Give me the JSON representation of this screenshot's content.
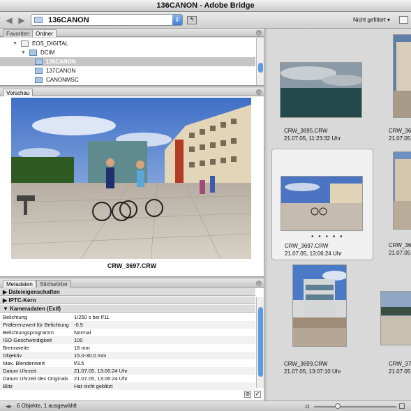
{
  "window": {
    "title": "136CANON - Adobe Bridge"
  },
  "toolbar": {
    "path": "136CANON",
    "filter": "Nicht gefiltert"
  },
  "folder_panel": {
    "tabs": [
      "Favoriten",
      "Ordner"
    ],
    "items": [
      {
        "label": "EOS_DIGITAL",
        "expanded": true
      },
      {
        "label": "DCIM",
        "expanded": true
      },
      {
        "label": "136CANON",
        "selected": true
      },
      {
        "label": "137CANON"
      },
      {
        "label": "CANONMSC"
      }
    ]
  },
  "preview_panel": {
    "tab": "Vorschau",
    "filename": "CRW_3697.CRW"
  },
  "metadata_panel": {
    "tabs": [
      "Metadaten",
      "Stichwörter"
    ],
    "sections": [
      "Dateieigenschaften",
      "IPTC-Kern",
      "Kameradaten (Exif)"
    ],
    "rows": [
      {
        "key": "Belichtung",
        "value": "1/250 s bei f/11"
      },
      {
        "key": "Präferenzwert für Belichtung",
        "value": "-0.5"
      },
      {
        "key": "Belichtungsprogramm",
        "value": "Normal"
      },
      {
        "key": "ISO-Geschwindigkeit",
        "value": "100"
      },
      {
        "key": "Brennweite",
        "value": "18 mm"
      },
      {
        "key": "Objektiv",
        "value": "15.0-30.0 mm"
      },
      {
        "key": "Max. Blendenwert",
        "value": "f/3.5"
      },
      {
        "key": "Datum Uhrzeit",
        "value": "21.07.05, 13:06:24 Uhr"
      },
      {
        "key": "Datum Uhrzeit des Originals",
        "value": "21.07.05, 13:06:24 Uhr"
      },
      {
        "key": "Blitz",
        "value": "Hat nicht geblitzt"
      }
    ]
  },
  "thumbnails": [
    {
      "name": "CRW_3695.CRW",
      "date": "21.07.05, 11:23:32 Uhr"
    },
    {
      "name": "CRW_3696.CRW",
      "date": "21.07.05, 13:06:1"
    },
    {
      "name": "CRW_3697.CRW",
      "date": "21.07.05, 13:06:24 Uhr",
      "selected": true
    },
    {
      "name": "CRW_3698.CRW",
      "date": "21.07.05, 13:06:2"
    },
    {
      "name": "CRW_3699.CRW",
      "date": "21.07.05, 13:07:10 Uhr"
    },
    {
      "name": "CRW_3700.CRW",
      "date": "21.07.05, 13:07:1"
    }
  ],
  "status": {
    "text": "6 Objekte, 1 ausgewählt"
  },
  "zoom_slider": {
    "position": 0.27
  }
}
